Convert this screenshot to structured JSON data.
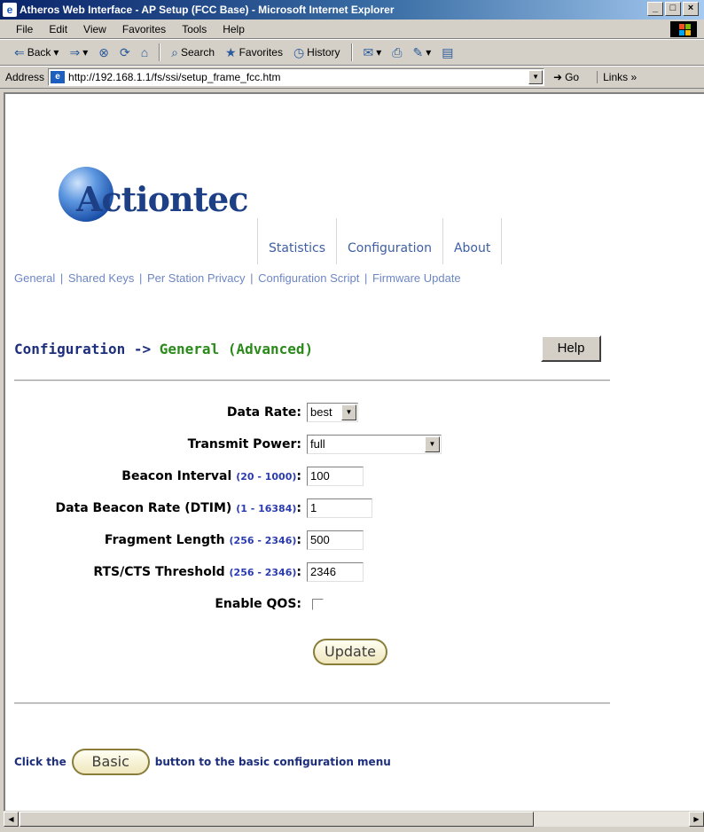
{
  "window": {
    "title": "Atheros Web Interface - AP Setup (FCC Base) - Microsoft Internet Explorer",
    "controls": [
      "_",
      "□",
      "×"
    ]
  },
  "menubar": {
    "items": [
      "File",
      "Edit",
      "View",
      "Favorites",
      "Tools",
      "Help"
    ]
  },
  "toolbar": {
    "back_label": "Back",
    "search_label": "Search",
    "favorites_label": "Favorites",
    "history_label": "History"
  },
  "addressbar": {
    "label": "Address",
    "url": "http://192.168.1.1/fs/ssi/setup_frame_fcc.htm",
    "go_label": "Go",
    "links_label": "Links »"
  },
  "brand": {
    "logo_text": "Actiontec"
  },
  "topnav": {
    "items": [
      "Statistics",
      "Configuration",
      "About"
    ]
  },
  "subnav": {
    "items": [
      "General",
      "Shared Keys",
      "Per Station Privacy",
      "Configuration Script",
      "Firmware Update"
    ],
    "separator": "|"
  },
  "heading": {
    "section": "Configuration -> ",
    "subsection": "General (Advanced)"
  },
  "help_button": "Help",
  "form": {
    "data_rate": {
      "label": "Data Rate:",
      "value": "best"
    },
    "transmit_power": {
      "label": "Transmit Power:",
      "value": "full"
    },
    "beacon_interval": {
      "label": "Beacon Interval ",
      "range": "(20 - 1000)",
      "colon": ":",
      "value": "100"
    },
    "dtim": {
      "label": "Data Beacon Rate (DTIM) ",
      "range": "(1 - 16384)",
      "colon": ":",
      "value": "1"
    },
    "fragment_length": {
      "label": "Fragment Length ",
      "range": "(256 - 2346)",
      "colon": ":",
      "value": "500"
    },
    "rts_cts": {
      "label": "RTS/CTS Threshold ",
      "range": "(256 - 2346)",
      "colon": ":",
      "value": "2346"
    },
    "enable_qos": {
      "label": "Enable QOS:",
      "checked": false
    },
    "update_button": "Update"
  },
  "footer": {
    "prefix": "Click the",
    "basic_button": "Basic",
    "suffix": "button to the basic configuration menu"
  }
}
